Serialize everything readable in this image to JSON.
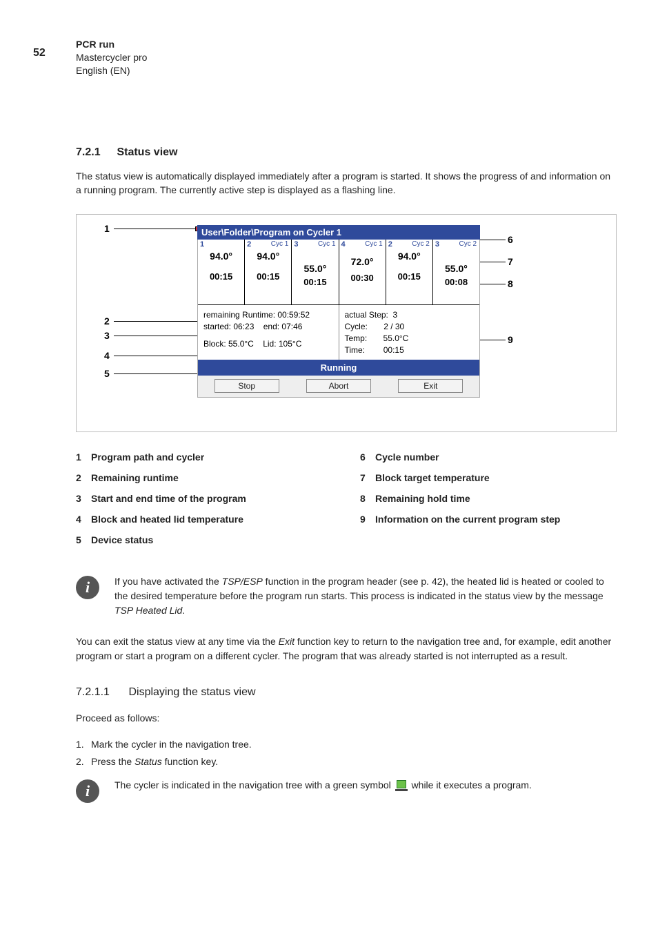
{
  "page_number": "52",
  "header": {
    "title": "PCR run",
    "subtitle": "Mastercycler pro",
    "lang": "English (EN)"
  },
  "section": {
    "num": "7.2.1",
    "title": "Status view"
  },
  "intro": "The status view is automatically displayed immediately after a program is started. It shows the progress of and information on a running program. The currently active step is displayed as a flashing line.",
  "screenshot": {
    "title": "User\\Folder\\Program on Cycler 1",
    "steps": [
      {
        "idx": "1",
        "cyc": "",
        "temp": "94.0°",
        "time": "00:15",
        "cls": ""
      },
      {
        "idx": "2",
        "cyc": "Cyc 1",
        "temp": "94.0°",
        "time": "00:15",
        "cls": ""
      },
      {
        "idx": "3",
        "cyc": "Cyc 1",
        "temp": "55.0°",
        "time": "00:15",
        "cls": "low"
      },
      {
        "idx": "4",
        "cyc": "Cyc 1",
        "temp": "72.0°",
        "time": "00:30",
        "cls": "mid"
      },
      {
        "idx": "2",
        "cyc": "Cyc 2",
        "temp": "94.0°",
        "time": "00:15",
        "cls": ""
      },
      {
        "idx": "3",
        "cyc": "Cyc 2",
        "temp": "55.0°",
        "time": "00:08",
        "cls": "low"
      }
    ],
    "left_info": {
      "l1": "remaining Runtime: 00:59:52",
      "l2a": "started: 06:23",
      "l2b": "end: 07:46",
      "l3a": "Block: 55.0°C",
      "l3b": "Lid: 105°C"
    },
    "right_info": {
      "r1a": "actual Step:",
      "r1b": "3",
      "r2a": "Cycle:",
      "r2b": "2 / 30",
      "r3a": "Temp:",
      "r3b": "55.0°C",
      "r4a": "Time:",
      "r4b": "00:15"
    },
    "status": "Running",
    "buttons": {
      "stop": "Stop",
      "abort": "Abort",
      "exit": "Exit"
    }
  },
  "legend_left": [
    {
      "n": "1",
      "t": "Program path and cycler"
    },
    {
      "n": "2",
      "t": "Remaining runtime"
    },
    {
      "n": "3",
      "t": "Start and end time of the program"
    },
    {
      "n": "4",
      "t": "Block and heated lid temperature"
    },
    {
      "n": "5",
      "t": "Device status"
    }
  ],
  "legend_right": [
    {
      "n": "6",
      "t": "Cycle number"
    },
    {
      "n": "7",
      "t": "Block target temperature"
    },
    {
      "n": "8",
      "t": "Remaining hold time"
    },
    {
      "n": "9",
      "t": "Information on the current program step"
    }
  ],
  "note1": {
    "pre": "If you have activated the ",
    "ital1": "TSP/ESP",
    "mid": " function in the program header (see p. 42), the heated lid is heated or cooled to the desired temperature before the program run starts. This process is indicated in the status view by the message ",
    "ital2": "TSP Heated Lid",
    "post": "."
  },
  "para2": {
    "pre": "You can exit the status view at any time via the ",
    "ital": "Exit",
    "post": " function key to return to the navigation tree and, for example, edit another program or start a program on a different cycler. The program that was already started is not interrupted as a result."
  },
  "subsection": {
    "num": "7.2.1.1",
    "title": "Displaying the status view"
  },
  "proceed": "Proceed as follows:",
  "steps_list": [
    "Mark the cycler in the navigation tree.",
    {
      "pre": "Press the ",
      "ital": "Status",
      "post": " function key."
    }
  ],
  "note2": {
    "pre": "The cycler is indicated in the navigation tree with a green symbol ",
    "post": " while it executes a program."
  }
}
